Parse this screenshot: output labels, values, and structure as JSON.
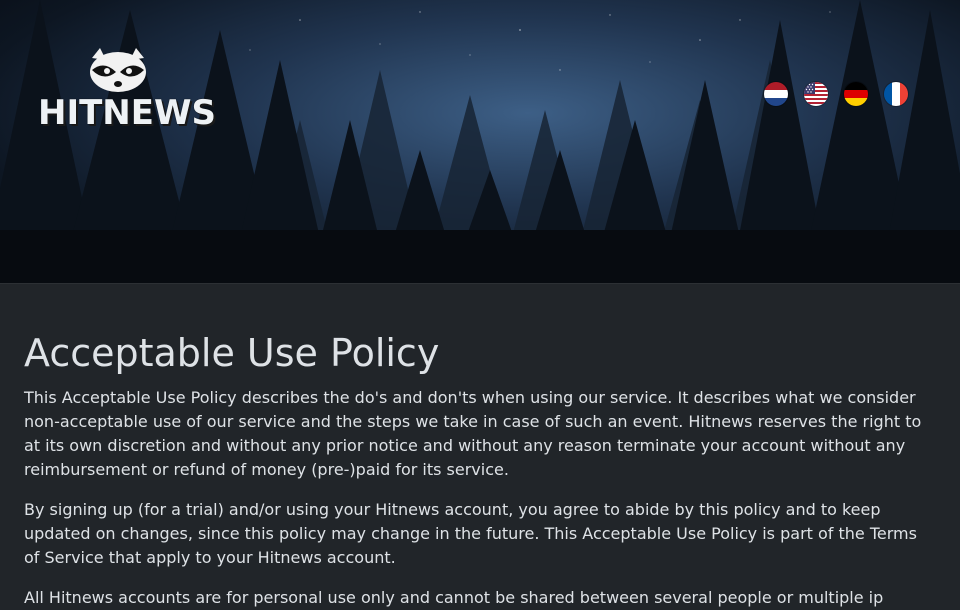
{
  "header": {
    "logo_text": "HITNEWS",
    "languages": [
      {
        "code": "nl",
        "icon": "netherlands-flag-icon"
      },
      {
        "code": "en",
        "icon": "usa-flag-icon"
      },
      {
        "code": "de",
        "icon": "germany-flag-icon"
      },
      {
        "code": "fr",
        "icon": "france-flag-icon"
      }
    ]
  },
  "main": {
    "title": "Acceptable Use Policy",
    "paragraphs": [
      "This Acceptable Use Policy describes the do's and don'ts when using our service. It describes what we consider non-acceptable use of our service and the steps we take in case of such an event. Hitnews reserves the right to at its own discretion and without any prior notice and without any reason terminate your account without any reimbursement or refund of money (pre-)paid for its service.",
      "By signing up (for a trial) and/or using your Hitnews account, you agree to abide by this policy and to keep updated on changes, since this policy may change in the future. This Acceptable Use Policy is part of the Terms of Service that apply to your Hitnews account.",
      "All Hitnews accounts are for personal use only and cannot be shared between several people or multiple ip"
    ]
  },
  "colors": {
    "page_bg": "#212529",
    "text": "#dee2e6"
  }
}
